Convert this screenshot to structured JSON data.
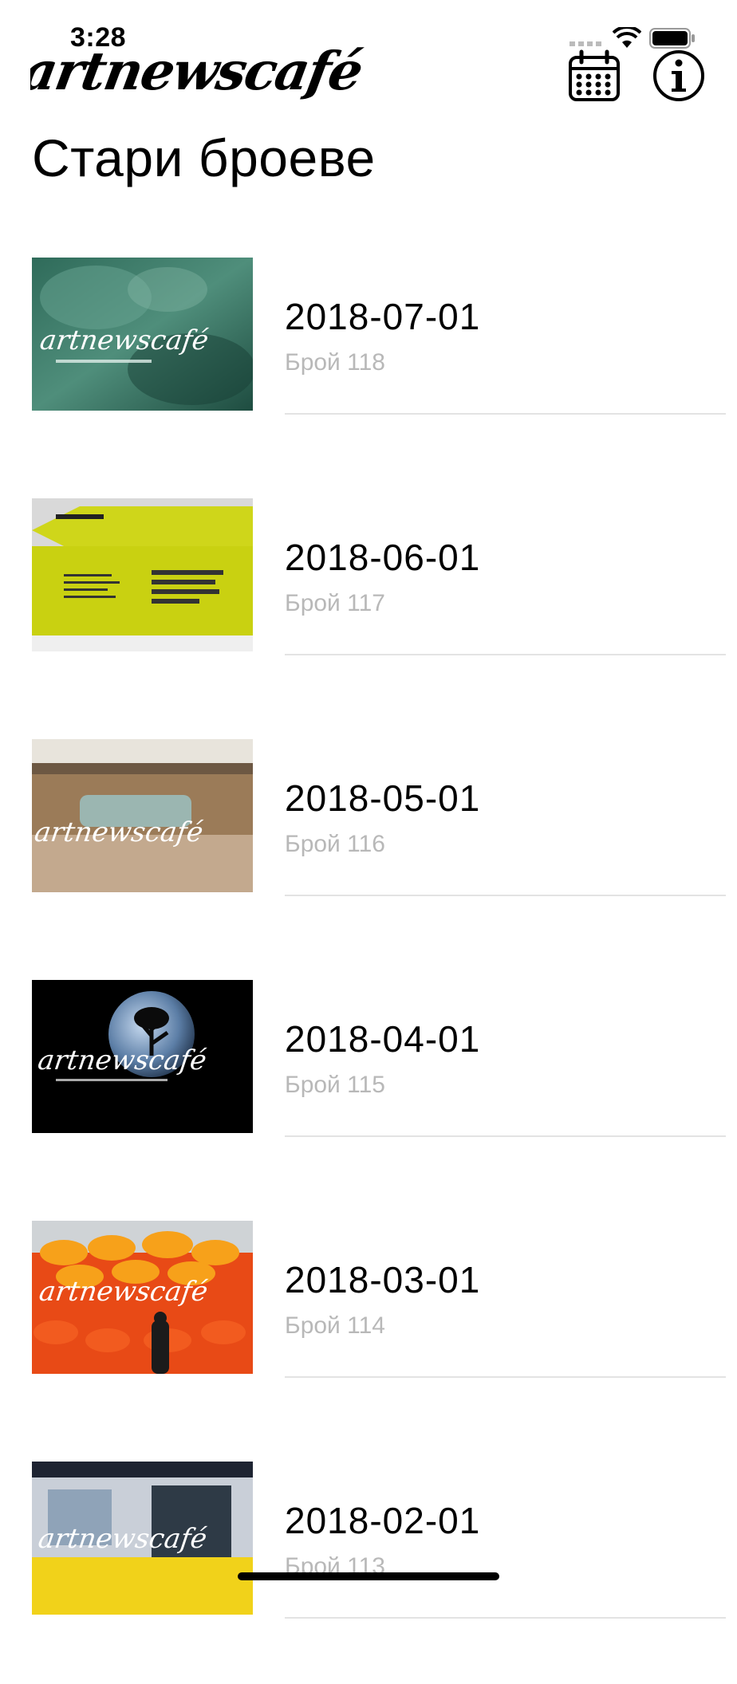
{
  "status_bar": {
    "time": "3:28"
  },
  "header": {
    "logo_text": "artnewscafé",
    "calendar_icon": "calendar-icon",
    "info_icon": "info-icon"
  },
  "page": {
    "title": "Стари броеве"
  },
  "issues": [
    {
      "date": "2018-07-01",
      "subtitle": "Брой 118"
    },
    {
      "date": "2018-06-01",
      "subtitle": "Брой 117"
    },
    {
      "date": "2018-05-01",
      "subtitle": "Брой 116"
    },
    {
      "date": "2018-04-01",
      "subtitle": "Брой 115"
    },
    {
      "date": "2018-03-01",
      "subtitle": "Брой 114"
    },
    {
      "date": "2018-02-01",
      "subtitle": "Брой 113"
    }
  ]
}
